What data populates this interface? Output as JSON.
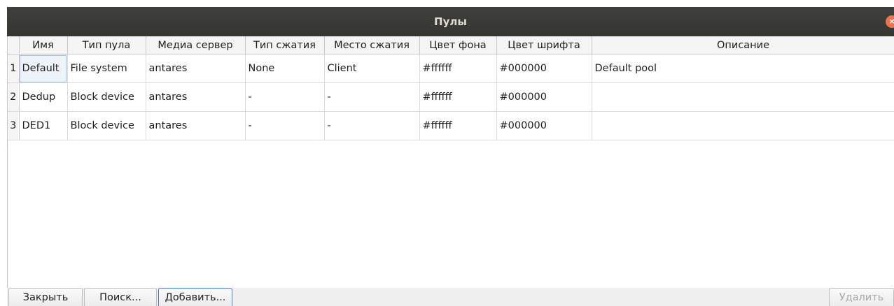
{
  "window": {
    "title": "Пулы",
    "close_symbol": "×"
  },
  "table": {
    "columns": [
      "Имя",
      "Тип пула",
      "Медиа сервер",
      "Тип сжатия",
      "Место сжатия",
      "Цвет фона",
      "Цвет шрифта",
      "Описание"
    ],
    "rows": [
      {
        "num": "1",
        "cells": [
          "Default",
          "File system",
          "antares",
          "None",
          "Client",
          "#ffffff",
          "#000000",
          "Default pool"
        ]
      },
      {
        "num": "2",
        "cells": [
          "Dedup",
          "Block device",
          "antares",
          "-",
          "-",
          "#ffffff",
          "#000000",
          ""
        ]
      },
      {
        "num": "3",
        "cells": [
          "DED1",
          "Block device",
          "antares",
          "-",
          "-",
          "#ffffff",
          "#000000",
          ""
        ]
      }
    ],
    "selected_cell": "Default"
  },
  "buttons": {
    "close": "Закрыть",
    "search": "Поиск...",
    "add": "Добавить...",
    "delete": "Удалить"
  },
  "colors": {
    "titlebar": "#3b3b38",
    "close_button": "#f0714b",
    "focus_border": "#4a7cc4"
  },
  "icons": {
    "close": "close-icon"
  }
}
